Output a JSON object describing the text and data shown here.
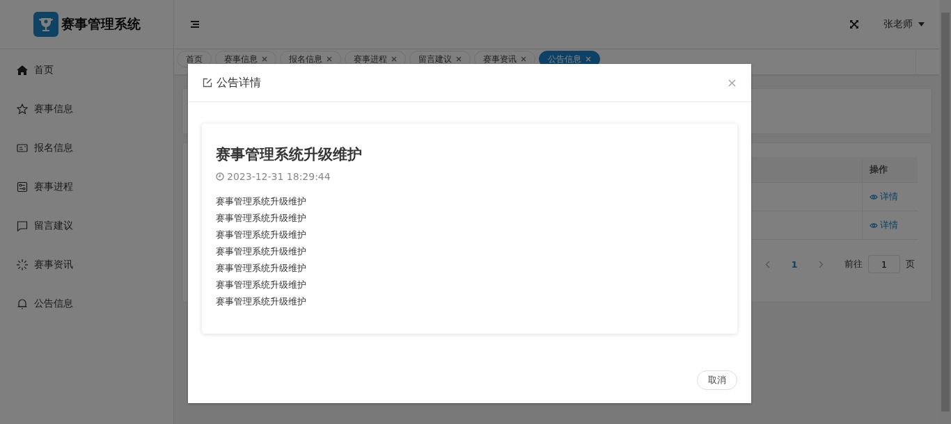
{
  "header": {
    "logo_text": "赛事管理系统",
    "user": "张老师"
  },
  "sidebar": {
    "items": [
      {
        "label": "首页"
      },
      {
        "label": "赛事信息"
      },
      {
        "label": "报名信息"
      },
      {
        "label": "赛事进程"
      },
      {
        "label": "留言建议"
      },
      {
        "label": "赛事资讯"
      },
      {
        "label": "公告信息"
      }
    ]
  },
  "tabs": [
    {
      "label": "首页",
      "selected": false,
      "closable": false
    },
    {
      "label": "赛事信息",
      "selected": false,
      "closable": true
    },
    {
      "label": "报名信息",
      "selected": false,
      "closable": true
    },
    {
      "label": "赛事进程",
      "selected": false,
      "closable": true
    },
    {
      "label": "留言建议",
      "selected": false,
      "closable": true
    },
    {
      "label": "赛事资讯",
      "selected": false,
      "closable": true
    },
    {
      "label": "公告信息",
      "selected": true,
      "closable": true
    }
  ],
  "table": {
    "columns": [
      "操作"
    ],
    "rows": [
      {
        "action": "详情"
      },
      {
        "action": "详情"
      }
    ]
  },
  "pagination": {
    "current": "1",
    "goto_label": "前往",
    "goto_value": "1",
    "page_unit": "页"
  },
  "modal": {
    "title": "公告详情",
    "article": {
      "title": "赛事管理系统升级维护",
      "time": "2023-12-31 18:29:44",
      "lines": [
        "赛事管理系统升级维护",
        "赛事管理系统升级维护",
        "赛事管理系统升级维护",
        "赛事管理系统升级维护",
        "赛事管理系统升级维护",
        "赛事管理系统升级维护",
        "赛事管理系统升级维护"
      ]
    },
    "cancel": "取消"
  }
}
